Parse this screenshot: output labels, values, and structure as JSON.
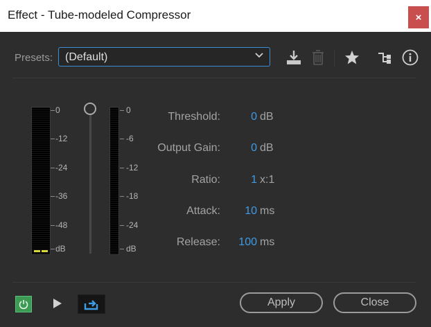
{
  "window": {
    "title": "Effect - Tube-modeled Compressor",
    "close_glyph": "×"
  },
  "presets": {
    "label": "Presets:",
    "selected": "(Default)",
    "toolbar_icons": [
      "save-preset-icon",
      "delete-preset-icon",
      "favorite-star-icon",
      "routing-icon",
      "info-icon"
    ]
  },
  "meters": {
    "input_scale": [
      "0",
      "-12",
      "-24",
      "-36",
      "-48",
      "dB"
    ],
    "output_scale": [
      "0",
      "-6",
      "-12",
      "-18",
      "-24",
      "dB"
    ],
    "active_color": "#d9d93a"
  },
  "params": [
    {
      "label": "Threshold:",
      "value": "0",
      "unit": "dB"
    },
    {
      "label": "Output Gain:",
      "value": "0",
      "unit": "dB"
    },
    {
      "label": "Ratio:",
      "value": "1",
      "unit": "x:1"
    },
    {
      "label": "Attack:",
      "value": "10",
      "unit": "ms"
    },
    {
      "label": "Release:",
      "value": "100",
      "unit": "ms"
    }
  ],
  "footer": {
    "apply_label": "Apply",
    "close_label": "Close"
  },
  "colors": {
    "accent": "#3f9be4",
    "power_on": "#3c9a55",
    "close_button": "#c94f4f"
  }
}
